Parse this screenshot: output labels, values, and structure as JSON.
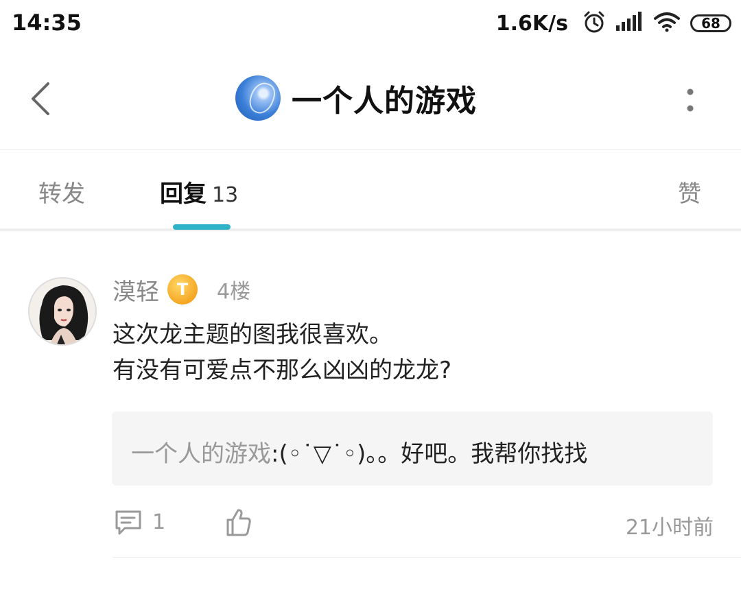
{
  "status_bar": {
    "time": "14:35",
    "net_speed": "1.6K/s",
    "battery": "68",
    "icons": [
      "alarm-icon",
      "signal-icon",
      "wifi-icon",
      "battery-icon"
    ]
  },
  "header": {
    "title": "一个人的游戏",
    "icons": [
      "back-arrow-icon",
      "more-vertical-icon"
    ]
  },
  "tabs": {
    "forward": "转发",
    "reply": "回复",
    "reply_count": "13",
    "like": "赞",
    "indicator_color": "#2fb3c7"
  },
  "post": {
    "username": "漠轻",
    "badge_letter": "T",
    "floor": "4楼",
    "content_lines": [
      "这次龙主题的图我很喜欢。",
      "有没有可爱点不那么凶凶的龙龙?"
    ],
    "quote": {
      "author": "一个人的游戏",
      "text": ":(◦˙▽˙◦)。。好吧。我帮你找找"
    },
    "comment_count": "1",
    "time_ago": "21小时前"
  }
}
